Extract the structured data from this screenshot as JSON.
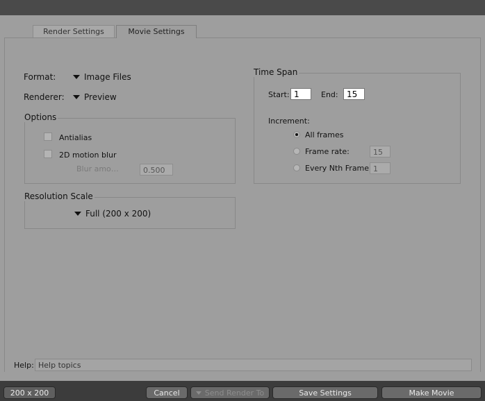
{
  "tabs": {
    "render_settings": "Render Settings",
    "movie_settings": "Movie Settings"
  },
  "format": {
    "label": "Format:",
    "value": "Image Files"
  },
  "renderer": {
    "label": "Renderer:",
    "value": "Preview"
  },
  "options": {
    "title": "Options",
    "antialias": {
      "label": "Antialias",
      "checked": false
    },
    "motion_blur": {
      "label": "2D motion blur",
      "checked": false
    },
    "blur_amount": {
      "label": "Blur amo…",
      "value": "0.500"
    }
  },
  "resolution_scale": {
    "title": "Resolution Scale",
    "value": "Full (200 x 200)"
  },
  "time_span": {
    "title": "Time Span",
    "start_label": "Start:",
    "start_value": "1",
    "end_label": "End:",
    "end_value": "15",
    "increment_label": "Increment:",
    "all_frames": "All frames",
    "frame_rate": {
      "label": "Frame rate:",
      "value": "15"
    },
    "every_nth": {
      "label": "Every Nth Frame:",
      "value": "1"
    },
    "selected": "all_frames"
  },
  "help": {
    "label": "Help:",
    "text": "Help topics"
  },
  "bottom": {
    "size": "200 x 200",
    "cancel": "Cancel",
    "send_render_to": "Send Render To",
    "save_settings": "Save Settings",
    "make_movie": "Make Movie"
  }
}
